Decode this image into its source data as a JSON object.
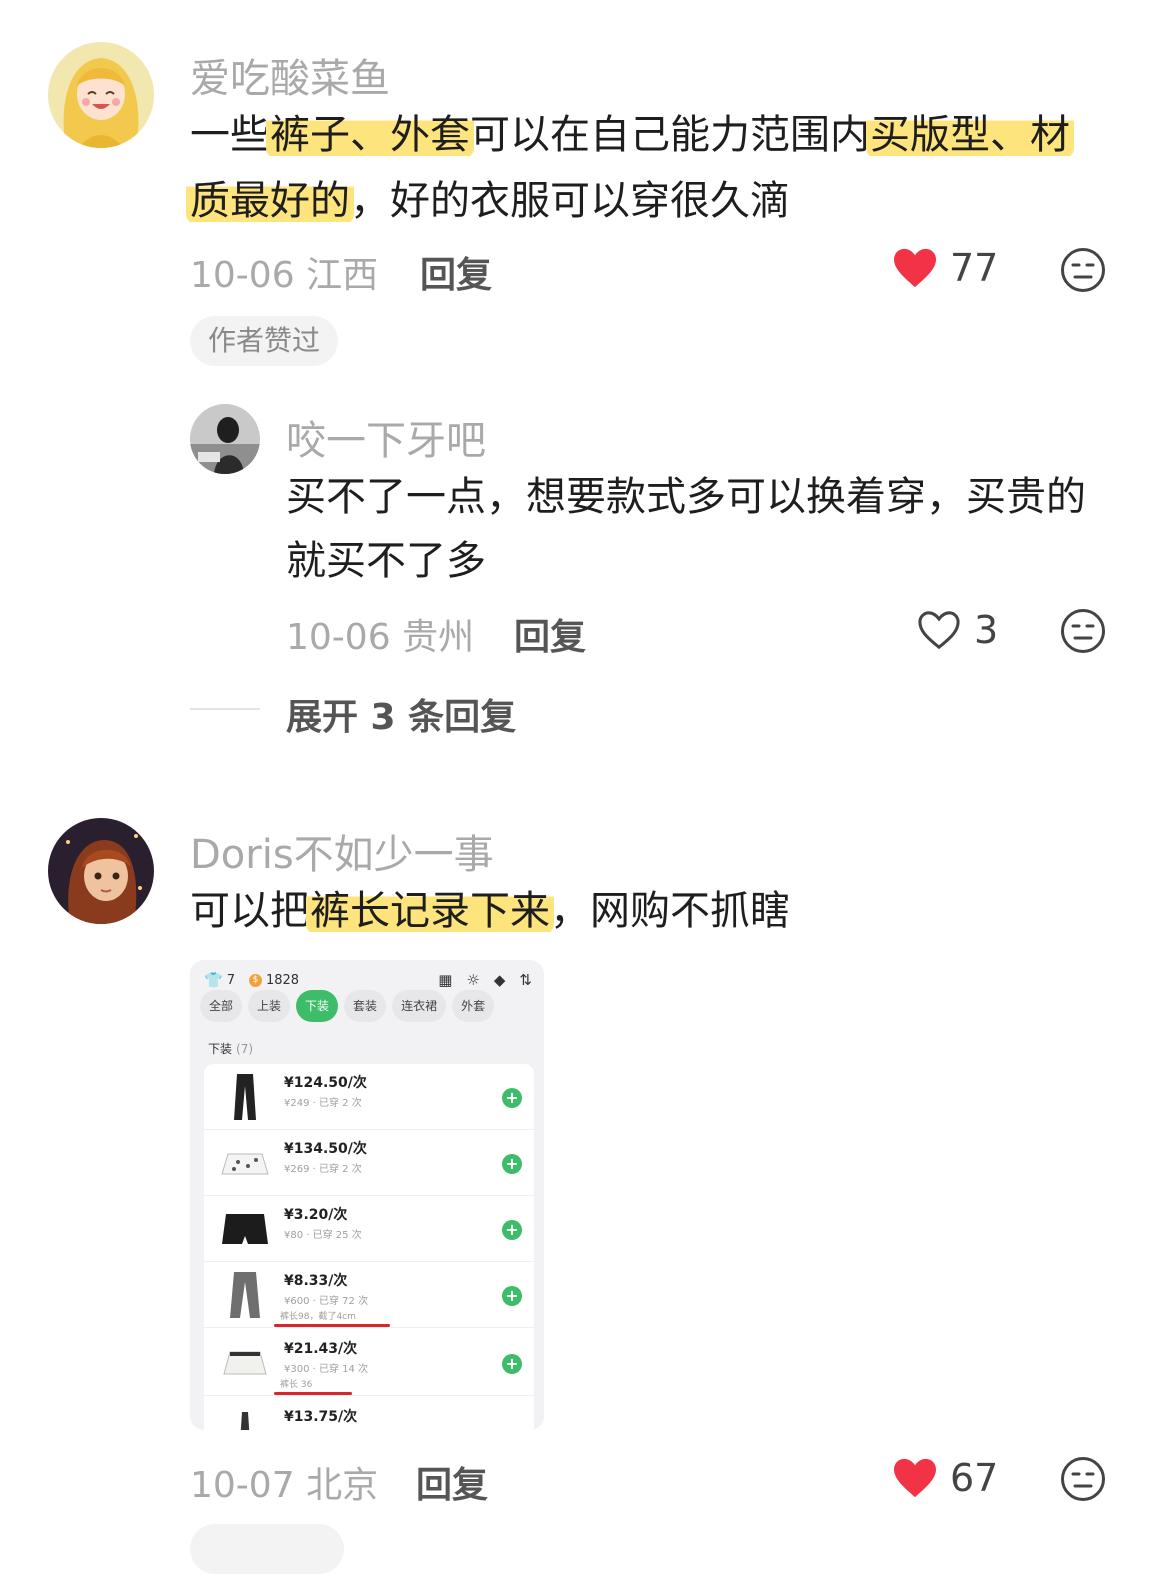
{
  "comments": [
    {
      "username": "爱吃酸菜鱼",
      "text_segments_line1": [
        {
          "t": "一些",
          "hl": false
        },
        {
          "t": "裤子、外套",
          "hl": true
        },
        {
          "t": "可以在自己能力范围内",
          "hl": false
        },
        {
          "t": "买版型、材",
          "hl": true
        }
      ],
      "text_segments_line2": [
        {
          "t": "质最好的",
          "hl": true
        },
        {
          "t": "，好的衣服可以穿很久滴",
          "hl": false
        }
      ],
      "date": "10-06",
      "location": "江西",
      "reply_label": "回复",
      "likes": "77",
      "liked": true,
      "badge": "作者赞过"
    },
    {
      "username": "咬一下牙吧",
      "line1": "买不了一点，想要款式多可以换着穿，买贵的",
      "line2": "就买不了多",
      "date": "10-06",
      "location": "贵州",
      "reply_label": "回复",
      "likes": "3",
      "liked": false
    },
    {
      "username": "Doris不如少一事",
      "text_segments_line1": [
        {
          "t": "可以把",
          "hl": false
        },
        {
          "t": "裤长记录下来",
          "hl": true
        },
        {
          "t": "，网购不抓瞎",
          "hl": false
        }
      ],
      "date": "10-07",
      "location": "北京",
      "reply_label": "回复",
      "likes": "67",
      "liked": true
    }
  ],
  "expand_replies": "展开 3 条回复",
  "embedded_app": {
    "stat_items": "7",
    "stat_coins": "1828",
    "tabs": [
      "全部",
      "上装",
      "下装",
      "套装",
      "连衣裙",
      "外套"
    ],
    "active_tab_index": 2,
    "section_title": "下装",
    "section_count": "(7)",
    "items": [
      {
        "price": "¥124.50/次",
        "sub": "¥249 · 已穿 2 次",
        "note": ""
      },
      {
        "price": "¥134.50/次",
        "sub": "¥269 · 已穿 2 次",
        "note": ""
      },
      {
        "price": "¥3.20/次",
        "sub": "¥80 · 已穿 25 次",
        "note": ""
      },
      {
        "price": "¥8.33/次",
        "sub": "¥600 · 已穿 72 次",
        "note": "裤长98，截了4cm"
      },
      {
        "price": "¥21.43/次",
        "sub": "¥300 · 已穿 14 次",
        "note": "裤长 36"
      },
      {
        "price": "¥13.75/次",
        "sub": "",
        "note": ""
      }
    ]
  },
  "colors": {
    "highlight": "#fde47c",
    "like_red": "#f23346",
    "app_green": "#3dbd6a",
    "underline_red": "#d8262a"
  }
}
